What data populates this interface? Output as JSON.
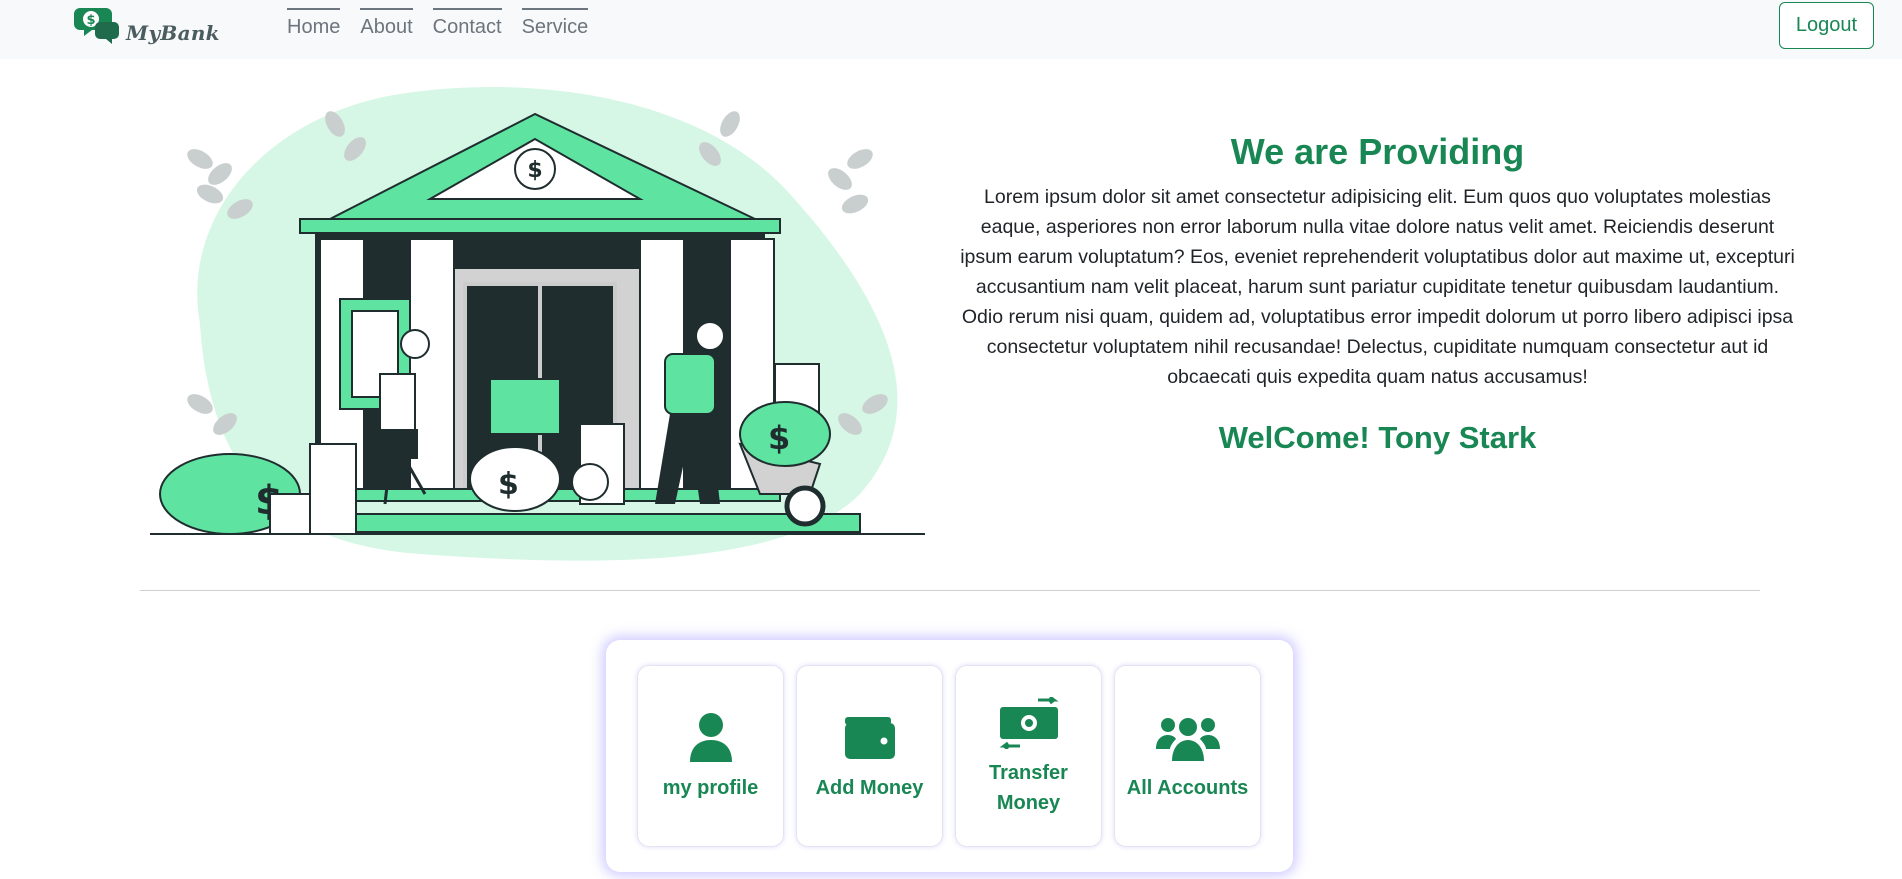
{
  "brand": {
    "name": "MyBank",
    "logo_icon": "dollar-chat-bubble-icon"
  },
  "nav": {
    "links": [
      "Home",
      "About",
      "Contact",
      "Service"
    ],
    "logout_label": "Logout"
  },
  "hero": {
    "title": "We are Providing",
    "paragraph": "Lorem ipsum dolor sit amet consectetur adipisicing elit. Eum quos quo voluptates molestias eaque, asperiores non error laborum nulla vitae dolore natus velit amet. Reiciendis deserunt ipsum earum voluptatum? Eos, eveniet reprehenderit voluptatibus dolor aut maxime ut, excepturi accusantium nam velit placeat, harum sunt pariatur cupiditate tenetur quibusdam laudantium. Odio rerum nisi quam, quidem ad, voluptatibus error impedit dolorum ut porro libero adipisci ipsa consectetur voluptatem nihil recusandae! Delectus, cupiditate numquam consectetur aut id obcaecati quis expedita quam natus accusamus!",
    "welcome": "WelCome! Tony Stark",
    "illustration": "bank-building-illustration"
  },
  "actions": [
    {
      "label": "my profile",
      "icon": "user-icon"
    },
    {
      "label": "Add Money",
      "icon": "wallet-icon"
    },
    {
      "label": "Transfer Money",
      "icon": "money-transfer-icon"
    },
    {
      "label": "All Accounts",
      "icon": "users-group-icon"
    }
  ],
  "colors": {
    "primary": "#198754",
    "accent_light": "#5ee3a1",
    "dark": "#1f2d2f",
    "panel_glow": "#7a6eff"
  }
}
